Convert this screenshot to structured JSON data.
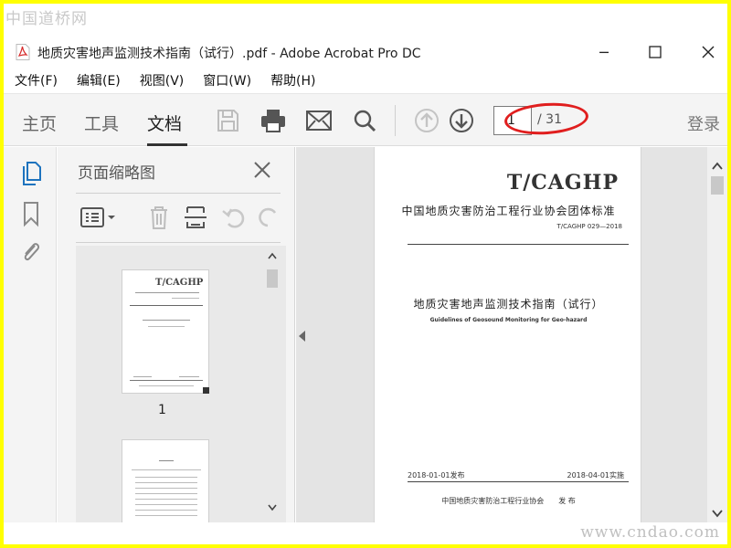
{
  "watermark": {
    "top": "中国道桥网",
    "bottom": "www.cndao.com"
  },
  "window": {
    "title": "地质灾害地声监测技术指南（试行）.pdf - Adobe Acrobat Pro DC",
    "minimize": "─",
    "maximize": "☐",
    "close": "✕"
  },
  "menu": [
    "文件(F)",
    "编辑(E)",
    "视图(V)",
    "窗口(W)",
    "帮助(H)"
  ],
  "tabs": [
    "主页",
    "工具",
    "文档"
  ],
  "active_tab": "文档",
  "toolbar": {
    "current_page": "1",
    "total_pages": "/ 31",
    "login": "登录",
    "icons": [
      "save-icon",
      "print-icon",
      "email-icon",
      "search-icon",
      "page-up-icon",
      "page-down-icon"
    ]
  },
  "left_rail": [
    "thumbnails-icon",
    "bookmark-icon",
    "attachment-icon"
  ],
  "panel": {
    "title": "页面缩略图",
    "thumbnail_labels": [
      "1"
    ]
  },
  "page": {
    "brand": "T/CAGHP",
    "association_standard": "中国地质灾害防治工程行业协会团体标准",
    "code": "T/CAGHP 029—2018",
    "title_zh": "地质灾害地声监测技术指南（试行）",
    "title_en": "Guidelines of Geosound Monitoring for Geo-hazard",
    "issue_date": "2018-01-01发布",
    "implement_date": "2018-04-01实施",
    "publisher": "中国地质灾害防治工程行业协会　　发 布"
  },
  "colors": {
    "highlight_oval": "#e01e1e",
    "accent_icon": "#1e73be"
  }
}
